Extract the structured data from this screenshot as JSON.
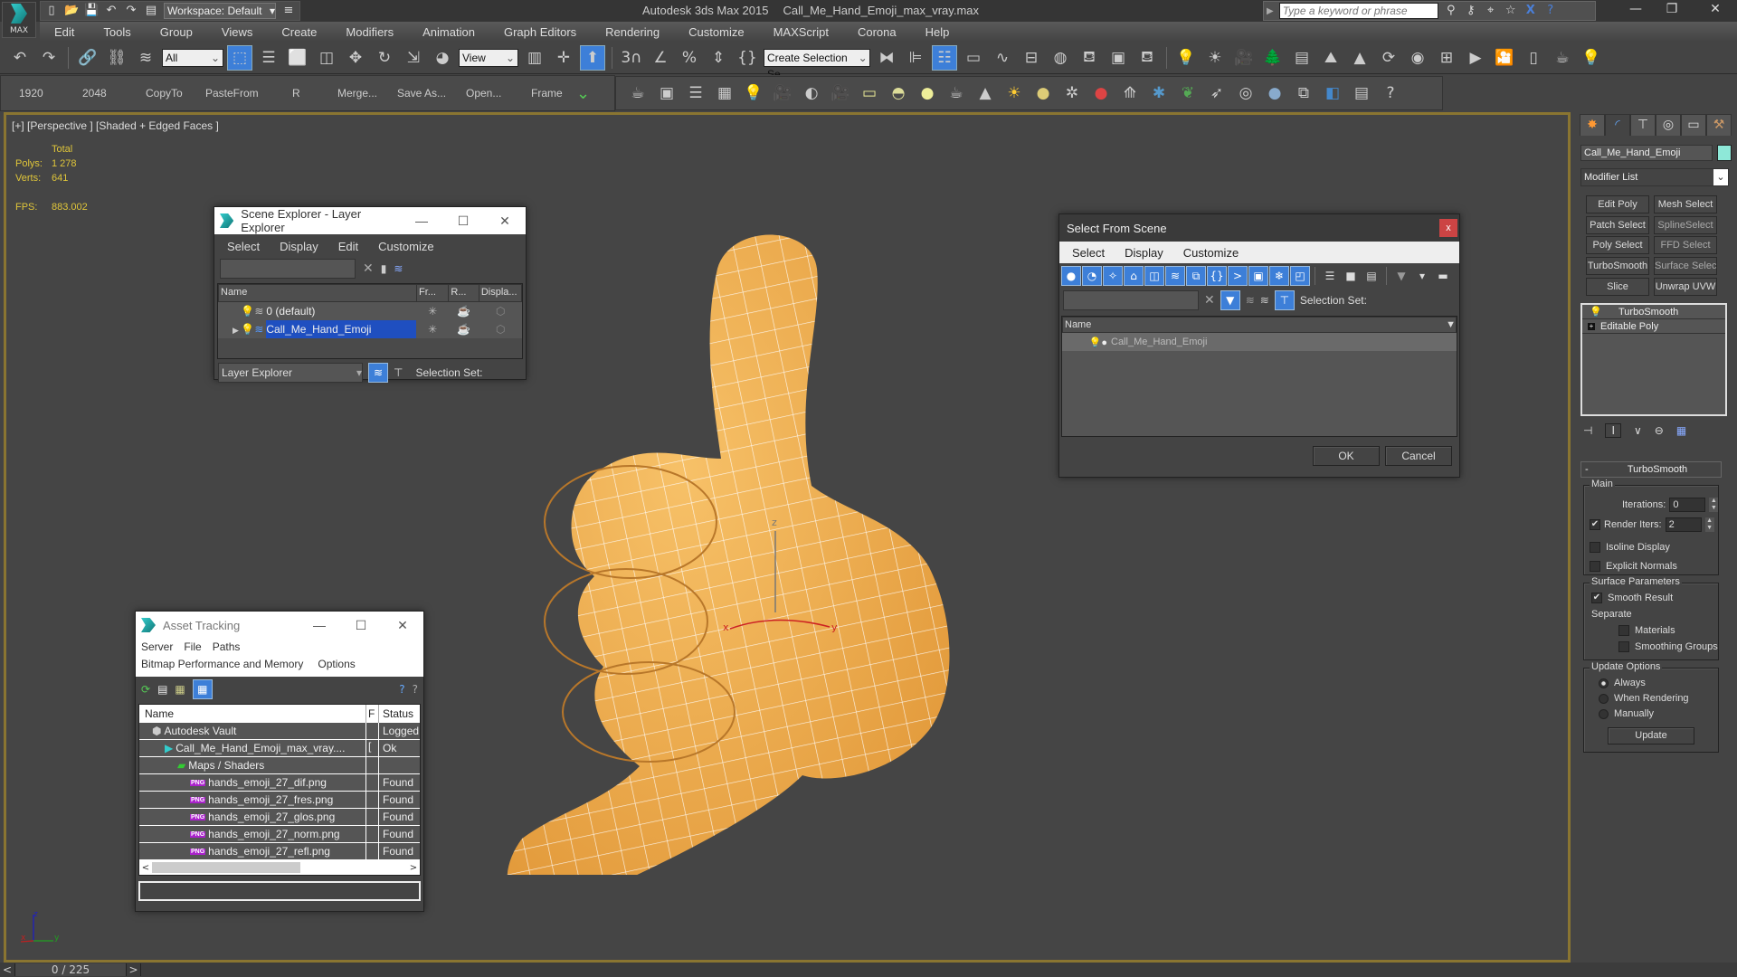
{
  "titlebar": {
    "workspace": "Workspace: Default",
    "app_name": "Autodesk 3ds Max  2015",
    "file_name": "Call_Me_Hand_Emoji_max_vray.max",
    "search_placeholder": "Type a keyword or phrase",
    "logo_label": "MAX"
  },
  "menubar": [
    "Edit",
    "Tools",
    "Group",
    "Views",
    "Create",
    "Modifiers",
    "Animation",
    "Graph Editors",
    "Rendering",
    "Customize",
    "MAXScript",
    "Corona",
    "Help"
  ],
  "toolbar": {
    "selection_filter": "All",
    "ref_coord": "View",
    "named_selection": "Create Selection Se"
  },
  "toolbar2": [
    "1920",
    "2048",
    "CopyTo",
    "PasteFrom",
    "R",
    "Merge...",
    "Save As...",
    "Open...",
    "Frame"
  ],
  "viewport": {
    "label": "[+] [Perspective ] [Shaded + Edged Faces ]",
    "stats": {
      "total_label": "Total",
      "polys_label": "Polys:",
      "polys": "1 278",
      "verts_label": "Verts:",
      "verts": "641",
      "fps_label": "FPS:",
      "fps": "883.002"
    },
    "model_color": "#f2b055",
    "gizmo": {
      "x": "x",
      "y": "y",
      "z": "z"
    }
  },
  "scene_explorer": {
    "title": "Scene Explorer - Layer Explorer",
    "menu": [
      "Select",
      "Display",
      "Edit",
      "Customize"
    ],
    "columns": [
      "Name",
      "Fr...",
      "R...",
      "Displa..."
    ],
    "rows": [
      {
        "name": "0 (default)",
        "selected": false
      },
      {
        "name": "Call_Me_Hand_Emoji",
        "selected": true
      }
    ],
    "explorer_type": "Layer Explorer",
    "selection_set_label": "Selection Set:"
  },
  "select_from_scene": {
    "title": "Select From Scene",
    "menu": [
      "Select",
      "Display",
      "Customize"
    ],
    "column": "Name",
    "rows": [
      "Call_Me_Hand_Emoji"
    ],
    "selection_set_label": "Selection Set:",
    "ok": "OK",
    "cancel": "Cancel"
  },
  "asset_tracking": {
    "title": "Asset Tracking",
    "menu1": [
      "Server",
      "File",
      "Paths"
    ],
    "menu2": [
      "Bitmap Performance and Memory",
      "Options"
    ],
    "columns": [
      "Name",
      "F",
      "Status"
    ],
    "rows": [
      {
        "name": "Autodesk Vault",
        "f": "",
        "status": "Logged",
        "indent": 1,
        "icon": "vault"
      },
      {
        "name": "Call_Me_Hand_Emoji_max_vray....",
        "f": "[",
        "status": "Ok",
        "indent": 2,
        "icon": "max"
      },
      {
        "name": "Maps / Shaders",
        "f": "",
        "status": "",
        "indent": 3,
        "icon": "maps"
      },
      {
        "name": "hands_emoji_27_dif.png",
        "f": "",
        "status": "Found",
        "indent": 4,
        "icon": "png"
      },
      {
        "name": "hands_emoji_27_fres.png",
        "f": "",
        "status": "Found",
        "indent": 4,
        "icon": "png"
      },
      {
        "name": "hands_emoji_27_glos.png",
        "f": "",
        "status": "Found",
        "indent": 4,
        "icon": "png"
      },
      {
        "name": "hands_emoji_27_norm.png",
        "f": "",
        "status": "Found",
        "indent": 4,
        "icon": "png"
      },
      {
        "name": "hands_emoji_27_refl.png",
        "f": "",
        "status": "Found",
        "indent": 4,
        "icon": "png"
      }
    ],
    "png_tag": "PNG"
  },
  "command_panel": {
    "object_name": "Call_Me_Hand_Emoji",
    "object_color": "#8ee8d8",
    "modifier_list": "Modifier List",
    "modifier_buttons": [
      "Edit Poly",
      "Mesh Select",
      "Patch Select",
      "SplineSelect",
      "Poly Select",
      "FFD Select",
      "TurboSmooth",
      "Surface Select",
      "Slice",
      "Unwrap UVW"
    ],
    "stack": [
      "TurboSmooth",
      "Editable Poly"
    ],
    "rollout_title": "TurboSmooth",
    "main": {
      "label": "Main",
      "iterations_label": "Iterations:",
      "iterations": "0",
      "render_iters_label": "Render Iters:",
      "render_iters": "2",
      "render_iters_checked": true,
      "isoline": "Isoline Display",
      "isoline_checked": false,
      "explicit": "Explicit Normals",
      "explicit_checked": false
    },
    "surface": {
      "label": "Surface Parameters",
      "smooth_result": "Smooth Result",
      "smooth_checked": true,
      "separate": "Separate",
      "materials": "Materials",
      "smoothing_groups": "Smoothing Groups"
    },
    "update": {
      "label": "Update Options",
      "options": [
        "Always",
        "When Rendering",
        "Manually"
      ],
      "selected": "Always",
      "button": "Update"
    }
  },
  "statusbar": {
    "frame": "0 / 225",
    "prev": "<",
    "next": ">"
  }
}
